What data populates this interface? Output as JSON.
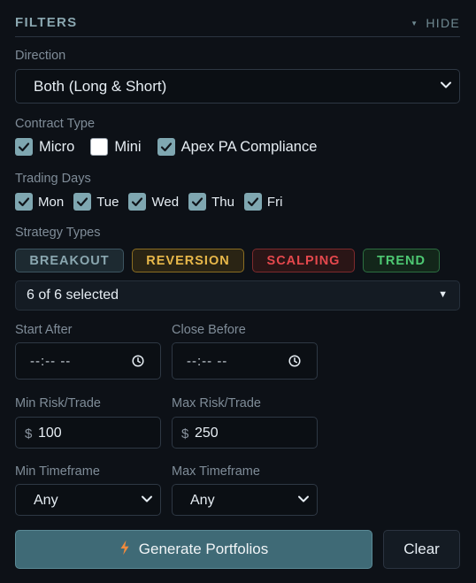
{
  "header": {
    "title": "FILTERS",
    "hide_label": "HIDE"
  },
  "direction": {
    "label": "Direction",
    "value": "Both (Long & Short)"
  },
  "contract_type": {
    "label": "Contract Type",
    "options": [
      {
        "label": "Micro",
        "checked": true
      },
      {
        "label": "Mini",
        "checked": false
      },
      {
        "label": "Apex PA Compliance",
        "checked": true
      }
    ]
  },
  "trading_days": {
    "label": "Trading Days",
    "days": [
      {
        "label": "Mon",
        "checked": true
      },
      {
        "label": "Tue",
        "checked": true
      },
      {
        "label": "Wed",
        "checked": true
      },
      {
        "label": "Thu",
        "checked": true
      },
      {
        "label": "Fri",
        "checked": true
      }
    ]
  },
  "strategy_types": {
    "label": "Strategy Types",
    "tags": [
      {
        "label": "BREAKOUT",
        "color": "#8aa7b0",
        "bg": "#1d2a31",
        "border": "#3d5561"
      },
      {
        "label": "REVERSION",
        "color": "#e8b84a",
        "bg": "#2a2414",
        "border": "#8b6d22"
      },
      {
        "label": "SCALPING",
        "color": "#e5484d",
        "bg": "#2a1516",
        "border": "#7e2a2d"
      },
      {
        "label": "TREND",
        "color": "#4ec973",
        "bg": "#13261a",
        "border": "#2c6e40"
      }
    ],
    "selection_summary": "6 of 6 selected"
  },
  "times": {
    "start_label": "Start After",
    "start_value": "--:-- --",
    "close_label": "Close Before",
    "close_value": "--:-- --"
  },
  "risk": {
    "min_label": "Min Risk/Trade",
    "min_currency": "$",
    "min_value": "100",
    "max_label": "Max Risk/Trade",
    "max_currency": "$",
    "max_value": "250"
  },
  "timeframe": {
    "min_label": "Min Timeframe",
    "min_value": "Any",
    "max_label": "Max Timeframe",
    "max_value": "Any"
  },
  "actions": {
    "generate_label": "Generate Portfolios",
    "clear_label": "Clear"
  },
  "icons": {
    "collapse": "caret-down-icon",
    "dropdown": "chevron-down-icon",
    "check": "checkmark-icon",
    "time": "clock-icon",
    "generate": "lightning-bolt-icon"
  },
  "colors": {
    "accent": "#3f6a76",
    "background": "#0d1117",
    "bolt": "#f08a3c"
  }
}
